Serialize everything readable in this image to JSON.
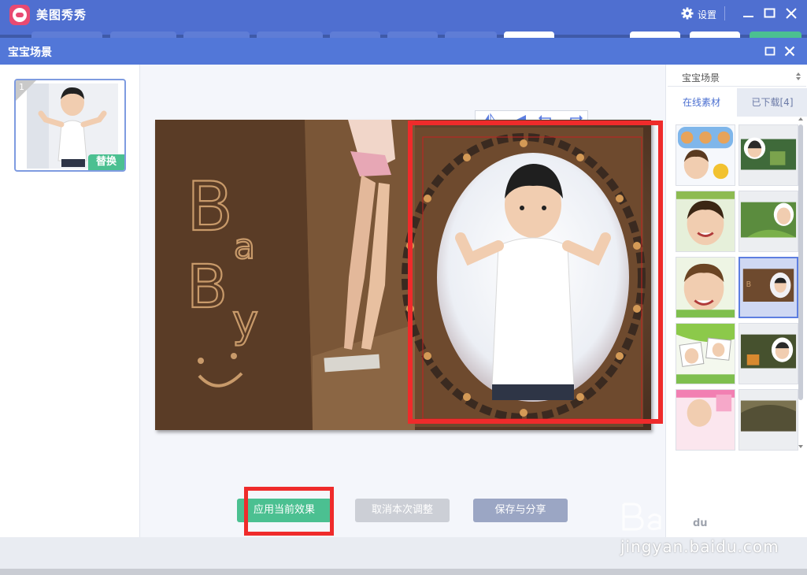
{
  "app": {
    "title": "美图秀秀",
    "settings_label": "设置",
    "accent": "#4f6fd0"
  },
  "dialog": {
    "title": "宝宝场景"
  },
  "thumbnail": {
    "index": "1",
    "replace_label": "替换"
  },
  "editor": {
    "tools": [
      "flip-horizontal-icon",
      "flip-vertical-icon",
      "rotate-left-icon",
      "rotate-right-icon"
    ],
    "scene_text": [
      "B",
      "a",
      "B",
      "y"
    ]
  },
  "actions": {
    "apply_label": "应用当前效果",
    "cancel_label": "取消本次调整",
    "save_label": "保存与分享"
  },
  "side": {
    "category": "宝宝场景",
    "tabs": [
      "在线素材",
      "已下载[4]"
    ],
    "selected_tile": 6
  },
  "colors": {
    "highlight_red": "#ef2b2b",
    "green_button": "#4bc091"
  },
  "watermark": {
    "site": "jingyan.baidu.com"
  }
}
